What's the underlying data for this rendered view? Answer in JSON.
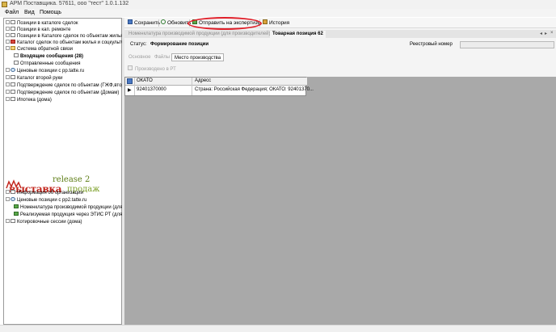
{
  "window": {
    "title": "АРМ Поставщика. 57611, ооо \"тест\" 1.0.1.132"
  },
  "menu": [
    "Файл",
    "Вид",
    "Помощь"
  ],
  "top_tree": [
    {
      "label": "Позиции в каталоге сделок",
      "icon": "doc-icon",
      "bold": false
    },
    {
      "label": "Позиции в кап. ремонте",
      "icon": "doc-icon",
      "bold": false
    },
    {
      "label": "Позиции в Каталоге сделок по объектам жилья и со",
      "icon": "doc-icon",
      "bold": false
    },
    {
      "label": "Каталог сделок по объектам жилья и соцкультбыта",
      "icon": "red-icon",
      "bold": false
    },
    {
      "label": "Система обратной связи",
      "icon": "folder-icon",
      "bold": false
    },
    {
      "label": "Входящие сообщения (28)",
      "icon": "doc-icon",
      "bold": true
    },
    {
      "label": "Отправленные сообщения",
      "icon": "doc-icon",
      "bold": false
    },
    {
      "label": "Ценовые позиции с pp.tatte.ru",
      "icon": "globe-icon",
      "bold": false
    },
    {
      "label": "Каталог второй руки",
      "icon": "doc-icon",
      "bold": false
    },
    {
      "label": "Подтверждение сделок по объектам (ГЖФ,второй р",
      "icon": "doc-icon",
      "bold": false
    },
    {
      "label": "Подтверждение сделок по объектам (Домам)",
      "icon": "doc-icon",
      "bold": false
    },
    {
      "label": "Ипотека (дома)",
      "icon": "doc-icon",
      "bold": false
    }
  ],
  "logo": {
    "release": "release 2",
    "word_main": "выставка",
    "word_suffix": "продаж"
  },
  "bottom_tree": [
    {
      "label": "Информация об организации",
      "icon": "doc-icon"
    },
    {
      "label": "Ценовые позиции с pp2.tatte.ru",
      "icon": "globe-icon"
    },
    {
      "label": "Номенклатура производимой продукции (для про",
      "icon": "green-icon"
    },
    {
      "label": "Реализуемая продукция через ЭТИС РТ (для реа",
      "icon": "green-icon"
    },
    {
      "label": "Котировочные сессии (дома)",
      "icon": "doc-icon"
    }
  ],
  "toolbar": {
    "save": "Сохранить",
    "refresh": "Обновить",
    "send_expertise": "Отправить на экспертизу",
    "history": "История"
  },
  "doc_tabs": {
    "inactive": "Номенклатура производимой продукции (для производителей)",
    "active": "Товарная позиция 62"
  },
  "status": {
    "label": "Статус:",
    "value": "Формирование позиции",
    "registry_label": "Реестровый номер",
    "registry_value": ""
  },
  "sub_tabs": [
    "Основное",
    "Файлы",
    "Место производства"
  ],
  "produced_checkbox": {
    "label": "Производено в РТ",
    "checked": false
  },
  "grid": {
    "columns": [
      "ОКАТО",
      "Адресс"
    ],
    "rows": [
      {
        "okato": "92401370000",
        "address": "Страна: Российская Федерация; ОКАТО: 92401370..."
      }
    ]
  },
  "colors": {
    "highlight": "#e0202a",
    "logo_red": "#c3271e",
    "logo_green": "#7a9e25"
  }
}
